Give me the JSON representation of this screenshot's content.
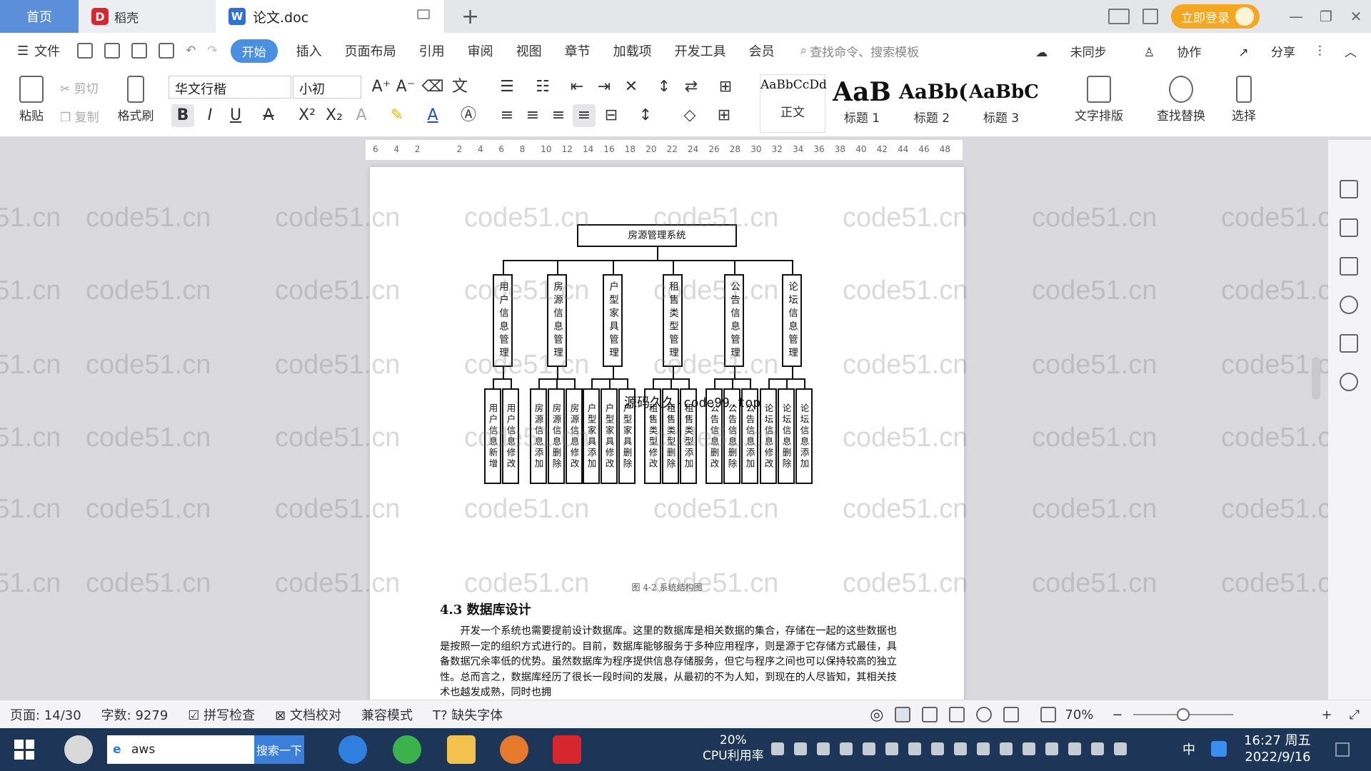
{
  "tabs": {
    "home": "首页",
    "docer": "稻壳",
    "document": "论文.doc"
  },
  "titlebar": {
    "login": "立即登录"
  },
  "menu": {
    "file": "文件",
    "items": [
      "开始",
      "插入",
      "页面布局",
      "引用",
      "审阅",
      "视图",
      "章节",
      "加载项",
      "开发工具",
      "会员"
    ],
    "search_placeholder": "查找命令、搜索模板",
    "sync": "未同步",
    "collab": "协作",
    "share": "分享"
  },
  "ribbon": {
    "paste": "粘贴",
    "cut": "剪切",
    "copy": "复制",
    "format_painter": "格式刷",
    "font_name": "华文行楷",
    "font_size": "小初",
    "styles": [
      {
        "sample": "AaBbCcDd",
        "name": "正文"
      },
      {
        "sample": "AaB",
        "name": "标题 1"
      },
      {
        "sample": "AaBb(",
        "name": "标题 2"
      },
      {
        "sample": "AaBbC",
        "name": "标题 3"
      }
    ],
    "text_layout": "文字排版",
    "find_replace": "查找替换",
    "select": "选择"
  },
  "ruler": {
    "ticks": [
      "6",
      "4",
      "2",
      "",
      "2",
      "4",
      "6",
      "8",
      "10",
      "12",
      "14",
      "16",
      "18",
      "20",
      "22",
      "24",
      "26",
      "28",
      "30",
      "32",
      "34",
      "36",
      "38",
      "40",
      "42",
      "44",
      "46",
      "48"
    ]
  },
  "document": {
    "root": "房源管理系统",
    "modules": [
      {
        "name": "用户信息管理",
        "children": [
          "用户信息新增",
          "用户信息修改"
        ]
      },
      {
        "name": "房源信息管理",
        "children": [
          "房源信息添加",
          "房源信息删除",
          "房源信息修改"
        ]
      },
      {
        "name": "户型家具管理",
        "children": [
          "户型家具添加",
          "户型家具修改",
          "户型家具删除"
        ]
      },
      {
        "name": "租售类型管理",
        "children": [
          "租售类型修改",
          "租售类型删除",
          "租售类型添加"
        ]
      },
      {
        "name": "公告信息管理",
        "children": [
          "公告信息删改",
          "公告信息删除",
          "公告信息添加"
        ]
      },
      {
        "name": "论坛信息管理",
        "children": [
          "论坛信息修改",
          "论坛信息删除",
          "论坛信息添加"
        ]
      }
    ],
    "overlay": "源码久久-code99.top",
    "figure_caption": "图 4-2  系统结构图",
    "section_heading": "4.3  数据库设计",
    "body": "开发一个系统也需要提前设计数据库。这里的数据库是相关数据的集合，存储在一起的这些数据也是按照一定的组织方式进行的。目前，数据库能够服务于多种应用程序，则是源于它存储方式最佳，具备数据冗余率低的优势。虽然数据库为程序提供信息存储服务，但它与程序之间也可以保持较高的独立性。总而言之，数据库经历了很长一段时间的发展，从最初的不为人知，到现在的人尽皆知，其相关技术也越发成熟，同时也拥"
  },
  "watermark": "code51.cn",
  "statusbar": {
    "page": "页面: 14/30",
    "words": "字数: 9279",
    "spellcheck": "拼写检查",
    "proofread": "文档校对",
    "compat": "兼容模式",
    "missing_font": "缺失字体",
    "zoom": "70%",
    "zoom_value": 0.7
  },
  "taskbar": {
    "search_text": "aws",
    "search_button": "搜索一下",
    "cpu_percent": "20%",
    "cpu_label": "CPU利用率",
    "time": "16:27 周五",
    "date": "2022/9/16",
    "ime": "中"
  },
  "colors": {
    "accent": "#4a90e2",
    "home_tab": "#5b8fd9",
    "login": "#f5a623",
    "taskbar": "#1d3556"
  }
}
